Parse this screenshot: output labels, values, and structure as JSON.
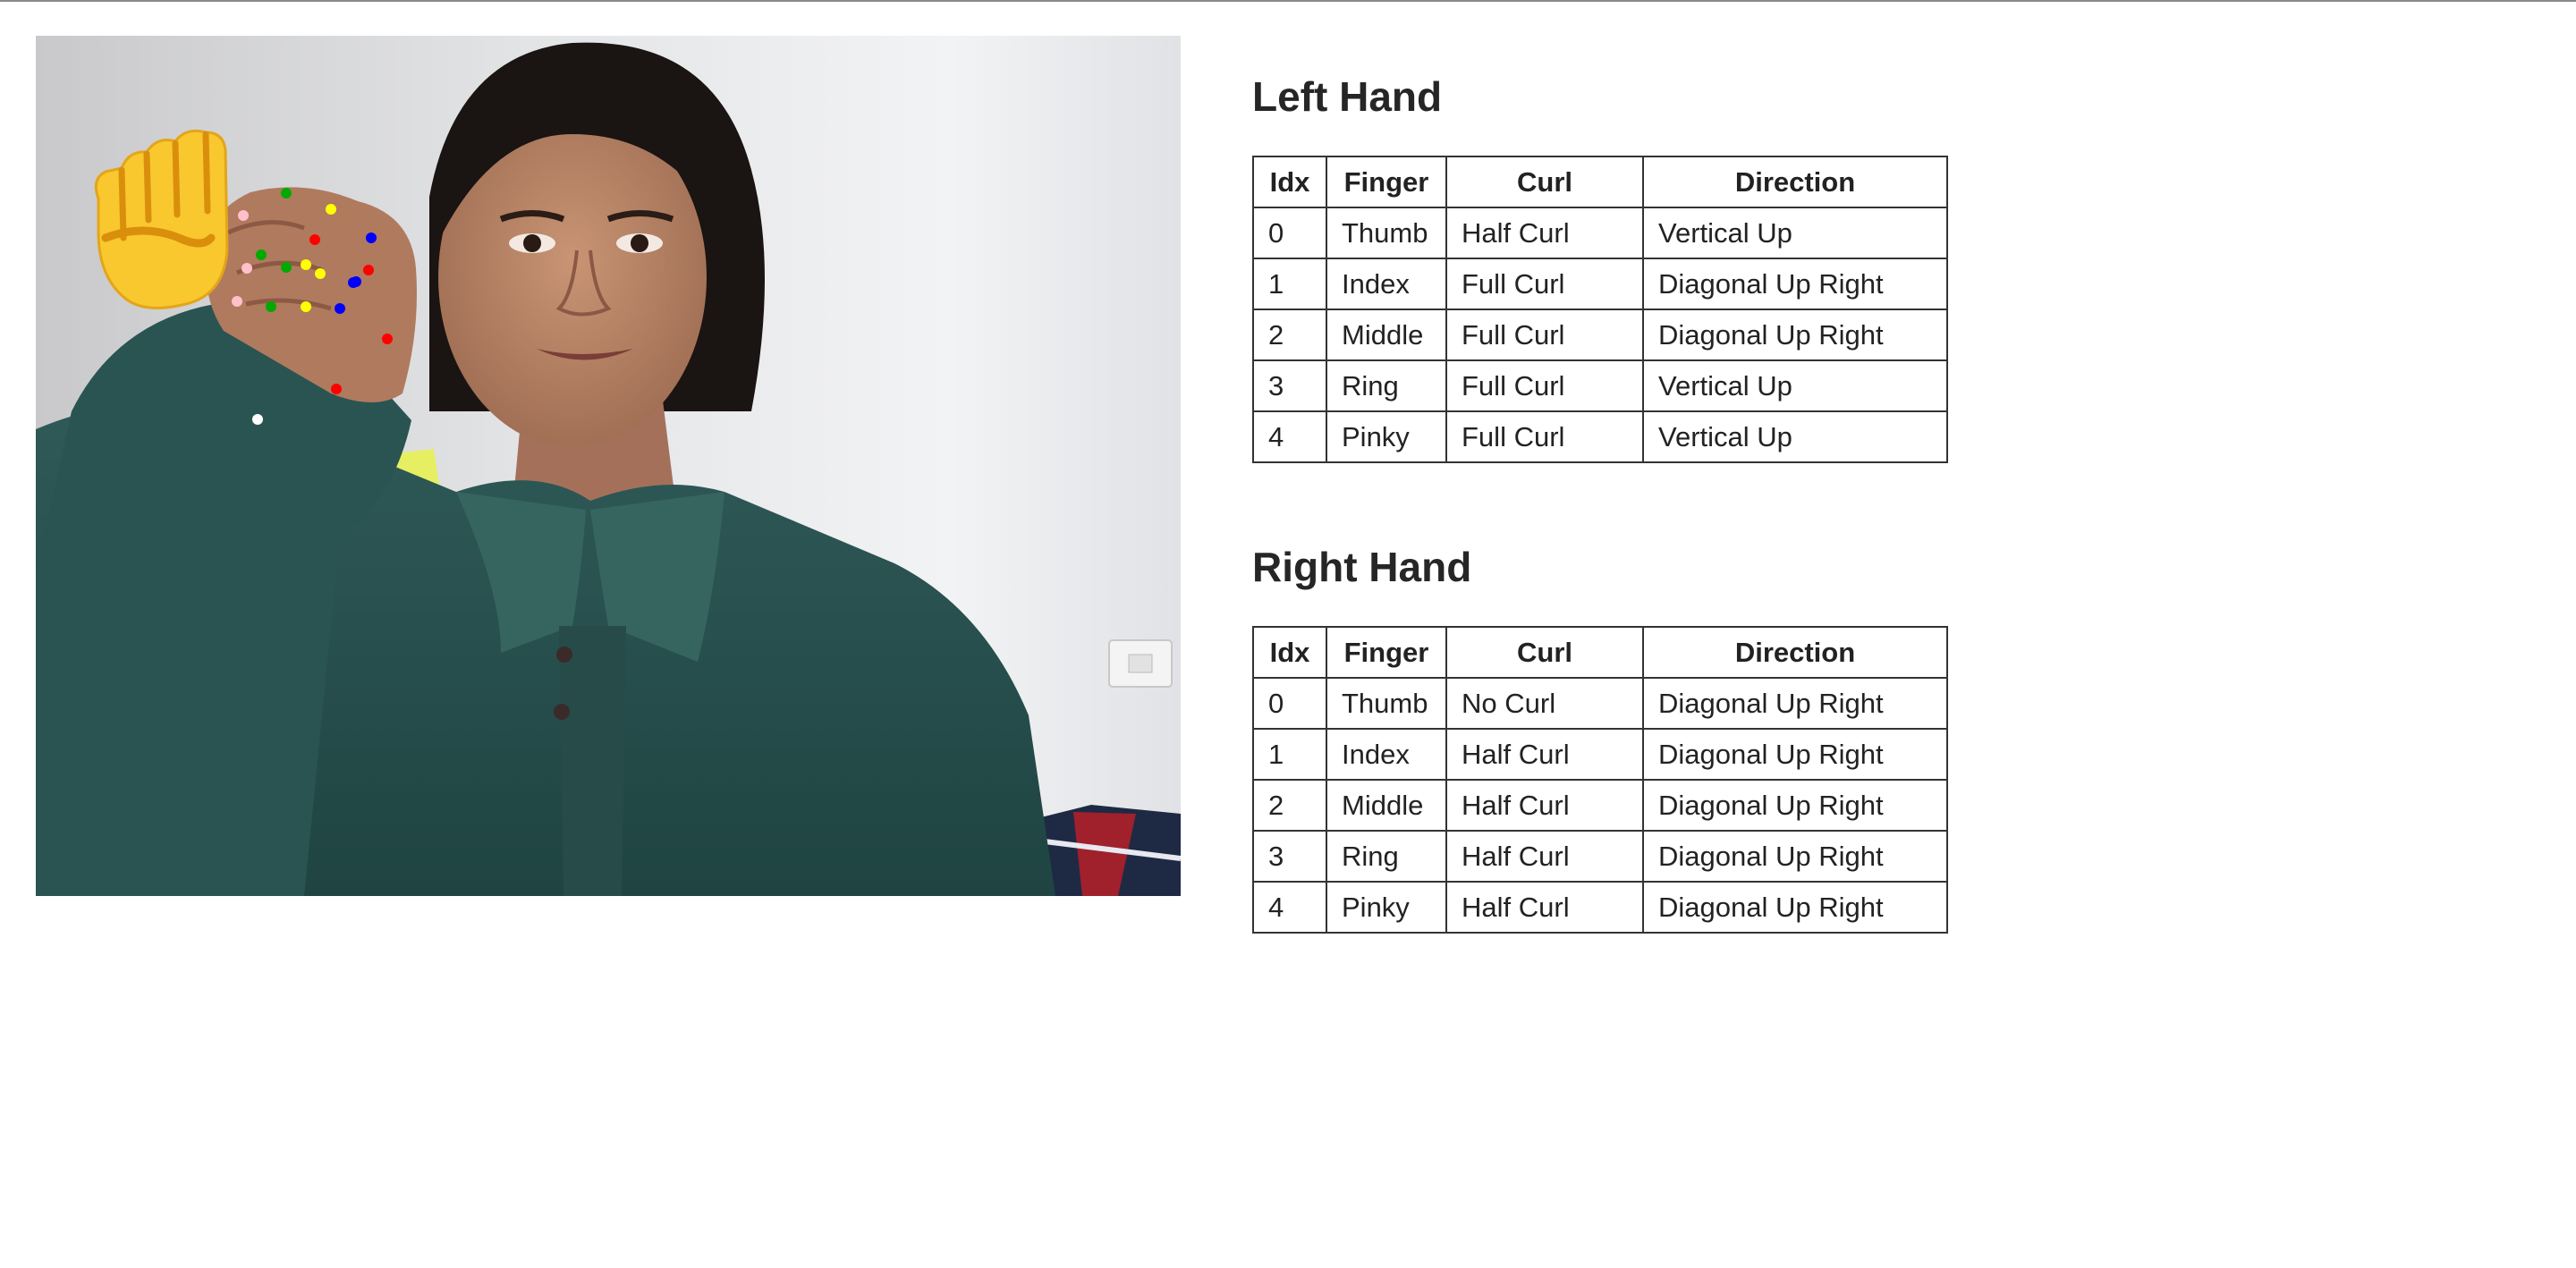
{
  "gesture": {
    "icon": "raised-fist-icon",
    "glyph": "✊"
  },
  "left_hand": {
    "heading": "Left Hand",
    "columns": [
      "Idx",
      "Finger",
      "Curl",
      "Direction"
    ],
    "rows": [
      {
        "idx": "0",
        "finger": "Thumb",
        "curl": "Half Curl",
        "direction": "Vertical Up"
      },
      {
        "idx": "1",
        "finger": "Index",
        "curl": "Full Curl",
        "direction": "Diagonal Up Right"
      },
      {
        "idx": "2",
        "finger": "Middle",
        "curl": "Full Curl",
        "direction": "Diagonal Up Right"
      },
      {
        "idx": "3",
        "finger": "Ring",
        "curl": "Full Curl",
        "direction": "Vertical Up"
      },
      {
        "idx": "4",
        "finger": "Pinky",
        "curl": "Full Curl",
        "direction": "Vertical Up"
      }
    ]
  },
  "right_hand": {
    "heading": "Right Hand",
    "columns": [
      "Idx",
      "Finger",
      "Curl",
      "Direction"
    ],
    "rows": [
      {
        "idx": "0",
        "finger": "Thumb",
        "curl": "No Curl",
        "direction": "Diagonal Up Right"
      },
      {
        "idx": "1",
        "finger": "Index",
        "curl": "Half Curl",
        "direction": "Diagonal Up Right"
      },
      {
        "idx": "2",
        "finger": "Middle",
        "curl": "Half Curl",
        "direction": "Diagonal Up Right"
      },
      {
        "idx": "3",
        "finger": "Ring",
        "curl": "Half Curl",
        "direction": "Diagonal Up Right"
      },
      {
        "idx": "4",
        "finger": "Pinky",
        "curl": "Half Curl",
        "direction": "Diagonal Up Right"
      }
    ]
  },
  "landmark_colors": {
    "thumb": "#ff0000",
    "index": "#0000ff",
    "middle": "#ffff00",
    "ring": "#00aa00",
    "pinky": "#ffc0cb",
    "wrist": "#ffffff"
  }
}
